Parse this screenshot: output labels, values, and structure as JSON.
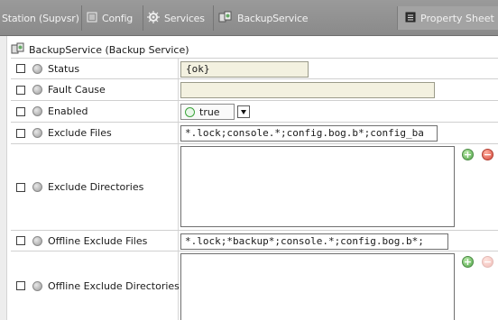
{
  "toolbar": {
    "station": "Station (Supvsr)",
    "config": "Config",
    "services": "Services",
    "backup_service": "BackupService",
    "property_sheet": "Property Sheet"
  },
  "header": {
    "title": "BackupService  (Backup Service)"
  },
  "rows": [
    {
      "label": "Status",
      "value": "{ok}"
    },
    {
      "label": "Fault Cause",
      "value": ""
    },
    {
      "label": "Enabled",
      "value": "true"
    },
    {
      "label": "Exclude Files",
      "value": "*.lock;console.*;config.bog.b*;config_ba"
    },
    {
      "label": "Exclude Directories",
      "value": ""
    },
    {
      "label": "Offline Exclude Files",
      "value": "*.lock;*backup*;console.*;config.bog.b*;"
    },
    {
      "label": "Offline Exclude Directories",
      "value": ""
    }
  ],
  "colors": {
    "toolbar_bg": "#8f8f8f",
    "readonly_field": "#f3f1e0",
    "add_button": "#52a84a",
    "remove_button": "#d84a3c"
  }
}
